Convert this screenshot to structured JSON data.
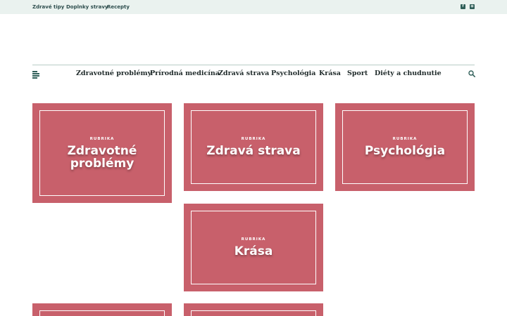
{
  "topbar": {
    "links": [
      "Zdravé tipy",
      "Doplnky stravy",
      "Recepty"
    ],
    "social": [
      {
        "icon": "facebook-icon",
        "glyph": "f"
      },
      {
        "icon": "rss-icon",
        "glyph": "◉"
      }
    ]
  },
  "nav": {
    "items": [
      "Zdravotné problémy",
      "Prírodná medicína",
      "Zdravá strava",
      "Psychológia",
      "Krása",
      "Sport",
      "Diéty a chudnutie"
    ]
  },
  "cards": [
    {
      "kicker": "RUBRIKA",
      "title_line1": "Zdravotné",
      "title_line2": "problémy"
    },
    {
      "kicker": "RUBRIKA",
      "title": "Zdravá strava"
    },
    {
      "kicker": "RUBRIKA",
      "title": "Psychológia"
    },
    {
      "kicker": "RUBRIKA",
      "title": "Krása"
    }
  ],
  "colors": {
    "card": "#c8606b",
    "topbar": "#eaf2ef",
    "accent": "#2f5e58"
  }
}
